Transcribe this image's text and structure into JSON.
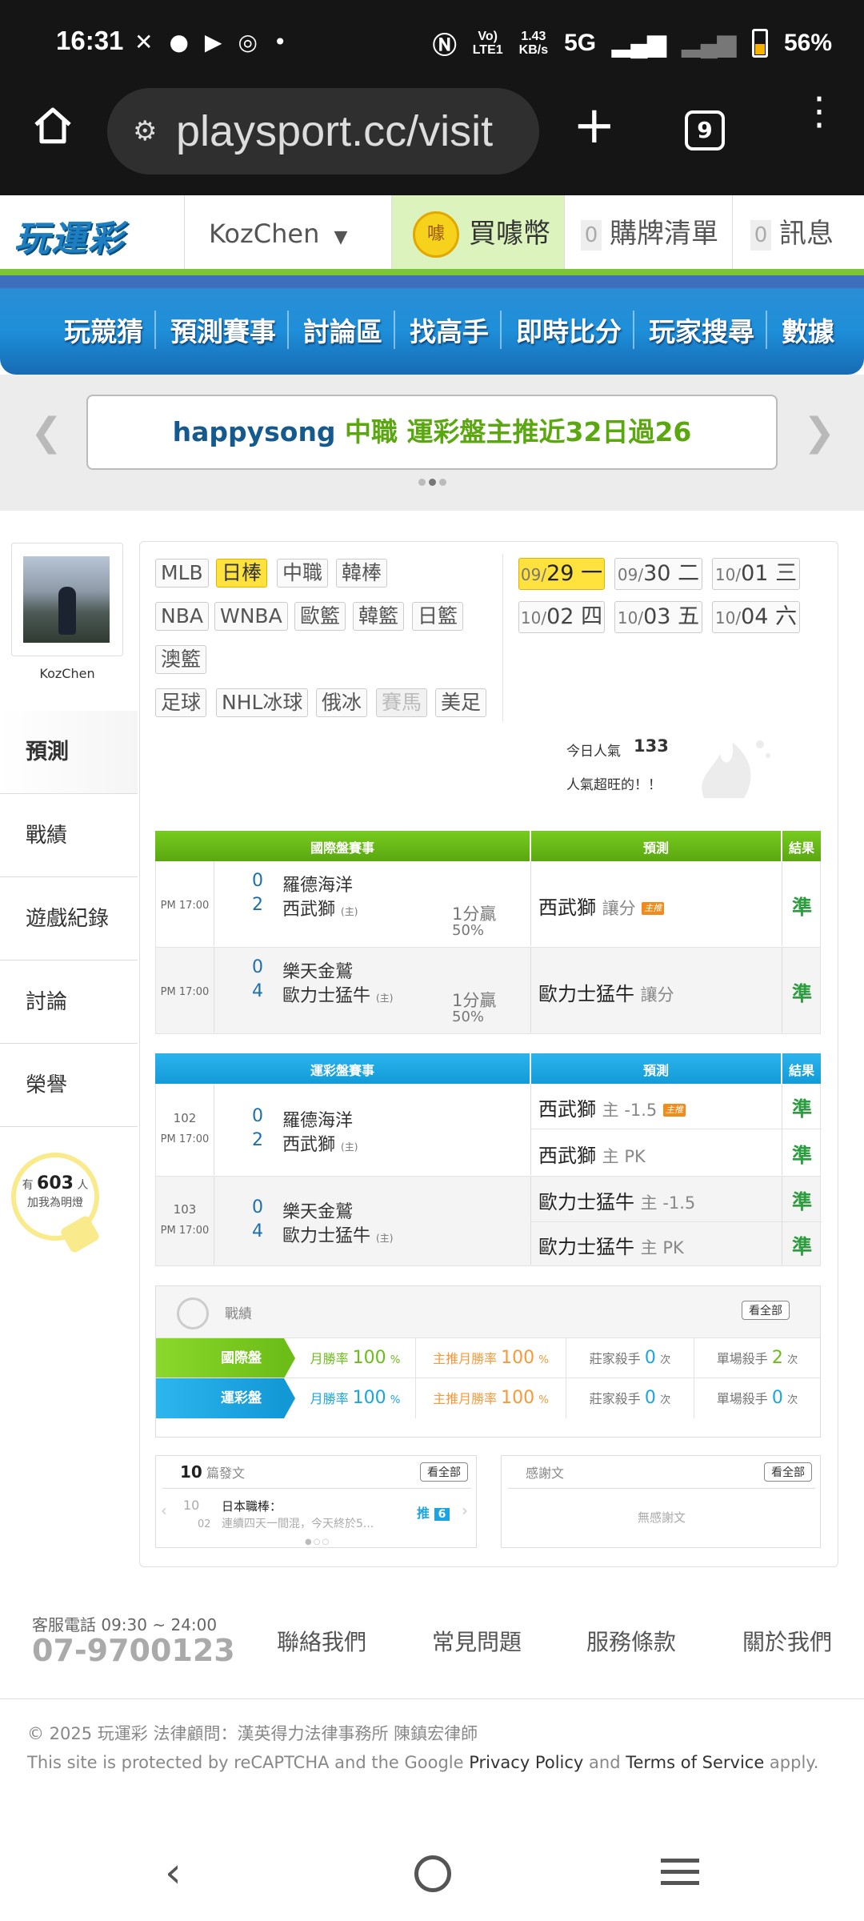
{
  "status_bar": {
    "time": "16:31",
    "net_speed_top": "1.43",
    "net_speed_bottom": "KB/s",
    "network": "5G",
    "battery": "56%",
    "volte_top": "Vo)",
    "volte_bottom": "LTE1"
  },
  "browser": {
    "url": "playsport.cc/visit",
    "tab_count": "9"
  },
  "header": {
    "logo": "玩運彩",
    "username": "KozChen",
    "buy_coin": "買噱幣",
    "coin_icon_text": "噱",
    "cart_count": "0",
    "cart_label": "購牌清單",
    "msg_count": "0",
    "msg_label": "訊息"
  },
  "nav": {
    "items": [
      "玩競猜",
      "預測賽事",
      "討論區",
      "找高手",
      "即時比分",
      "玩家搜尋",
      "數據"
    ]
  },
  "banner": {
    "user": "happysong",
    "text": " 中職 運彩盤主推近32日過26",
    "user_color": "#145a8f",
    "text_color": "#5aa710"
  },
  "profile": {
    "name": "KozChen",
    "menu": [
      "預測",
      "戰績",
      "遊戲紀錄",
      "討論",
      "榮譽"
    ],
    "fans_prefix": "有",
    "fans_count": "603",
    "fans_unit": "人",
    "fans_suffix": "加我為明燈"
  },
  "leagues": {
    "row1": [
      "MLB",
      "日棒",
      "中職",
      "韓棒"
    ],
    "row2": [
      "NBA",
      "WNBA",
      "歐籃",
      "韓籃",
      "日籃"
    ],
    "row3": [
      "澳籃"
    ],
    "row4": [
      "足球",
      "NHL冰球",
      "俄冰",
      "賽馬",
      "美足"
    ],
    "selected": "日棒"
  },
  "dates": [
    {
      "md": "09/",
      "d": "29",
      "w": "一",
      "selected": true
    },
    {
      "md": "09/",
      "d": "30",
      "w": "二"
    },
    {
      "md": "10/",
      "d": "01",
      "w": "三"
    },
    {
      "md": "10/",
      "d": "02",
      "w": "四"
    },
    {
      "md": "10/",
      "d": "03",
      "w": "五"
    },
    {
      "md": "10/",
      "d": "04",
      "w": "六"
    }
  ],
  "popularity": {
    "label": "今日人氣",
    "count": "133",
    "note": "人氣超旺的！！"
  },
  "intl_table": {
    "header": [
      "國際盤賽事",
      "預測",
      "結果"
    ],
    "rows": [
      {
        "time": "PM 17:00",
        "s1": "0",
        "t1": "羅德海洋",
        "s2": "2",
        "t2": "西武獅",
        "home": "(主)",
        "line1": "1分贏",
        "line2": "50%",
        "pick": "西武獅",
        "pick_note": "讓分",
        "badge": "主推",
        "result": "準"
      },
      {
        "time": "PM 17:00",
        "s1": "0",
        "t1": "樂天金鷲",
        "s2": "4",
        "t2": "歐力士猛牛",
        "home": "(主)",
        "line1": "1分贏",
        "line2": "50%",
        "pick": "歐力士猛牛",
        "pick_note": "讓分",
        "result": "準"
      }
    ]
  },
  "lottery_table": {
    "header": [
      "運彩盤賽事",
      "預測",
      "結果"
    ],
    "rows": [
      {
        "no": "102",
        "time": "PM 17:00",
        "s1": "0",
        "t1": "羅德海洋",
        "s2": "2",
        "t2": "西武獅",
        "home": "(主)",
        "picks": [
          {
            "team": "西武獅",
            "note": "主 -1.5",
            "badge": "主推",
            "result": "準"
          },
          {
            "team": "西武獅",
            "note": "主 PK",
            "result": "準"
          }
        ]
      },
      {
        "no": "103",
        "time": "PM 17:00",
        "s1": "0",
        "t1": "樂天金鷲",
        "s2": "4",
        "t2": "歐力士猛牛",
        "home": "(主)",
        "picks": [
          {
            "team": "歐力士猛牛",
            "note": "主 -1.5",
            "result": "準"
          },
          {
            "team": "歐力士猛牛",
            "note": "主 PK",
            "result": "準"
          }
        ]
      }
    ]
  },
  "record": {
    "title": "戰績",
    "view_all": "看全部",
    "rows": [
      {
        "label": "國際盤",
        "month_label": "月勝率",
        "month": "100",
        "main_label": "主推月勝率",
        "main": "100",
        "pct": "%",
        "dealer_label": "莊家殺手",
        "dealer": "0",
        "single_label": "單場殺手",
        "single": "2",
        "unit": "次",
        "color": "#78c81d"
      },
      {
        "label": "運彩盤",
        "month_label": "月勝率",
        "month": "100",
        "main_label": "主推月勝率",
        "main": "100",
        "pct": "%",
        "dealer_label": "莊家殺手",
        "dealer": "0",
        "single_label": "單場殺手",
        "single": "0",
        "unit": "次",
        "color": "#1ba4e2"
      }
    ]
  },
  "posts": {
    "count": "10",
    "label": "篇發文",
    "view_all": "看全部",
    "date_top": "10",
    "date_bottom": "02",
    "title": "日本職棒：",
    "snippet": "連續四天一間混，今天終於5...",
    "push": "推",
    "push_count": "6"
  },
  "thanks": {
    "label": "感謝文",
    "view_all": "看全部",
    "empty": "無感謝文"
  },
  "footer": {
    "phone_label": "客服電話 09:30 ~ 24:00",
    "phone": "07-9700123",
    "links": [
      "聯絡我們",
      "常見問題",
      "服務條款",
      "關於我們"
    ],
    "copyright": "© 2025 玩運彩 法律顧問：漢英得力法律事務所 陳鎮宏律師",
    "recaptcha_1": "This site is protected by reCAPTCHA and the Google ",
    "privacy": "Privacy Policy",
    "and": " and ",
    "terms": "Terms of Service",
    "apply": " apply."
  }
}
